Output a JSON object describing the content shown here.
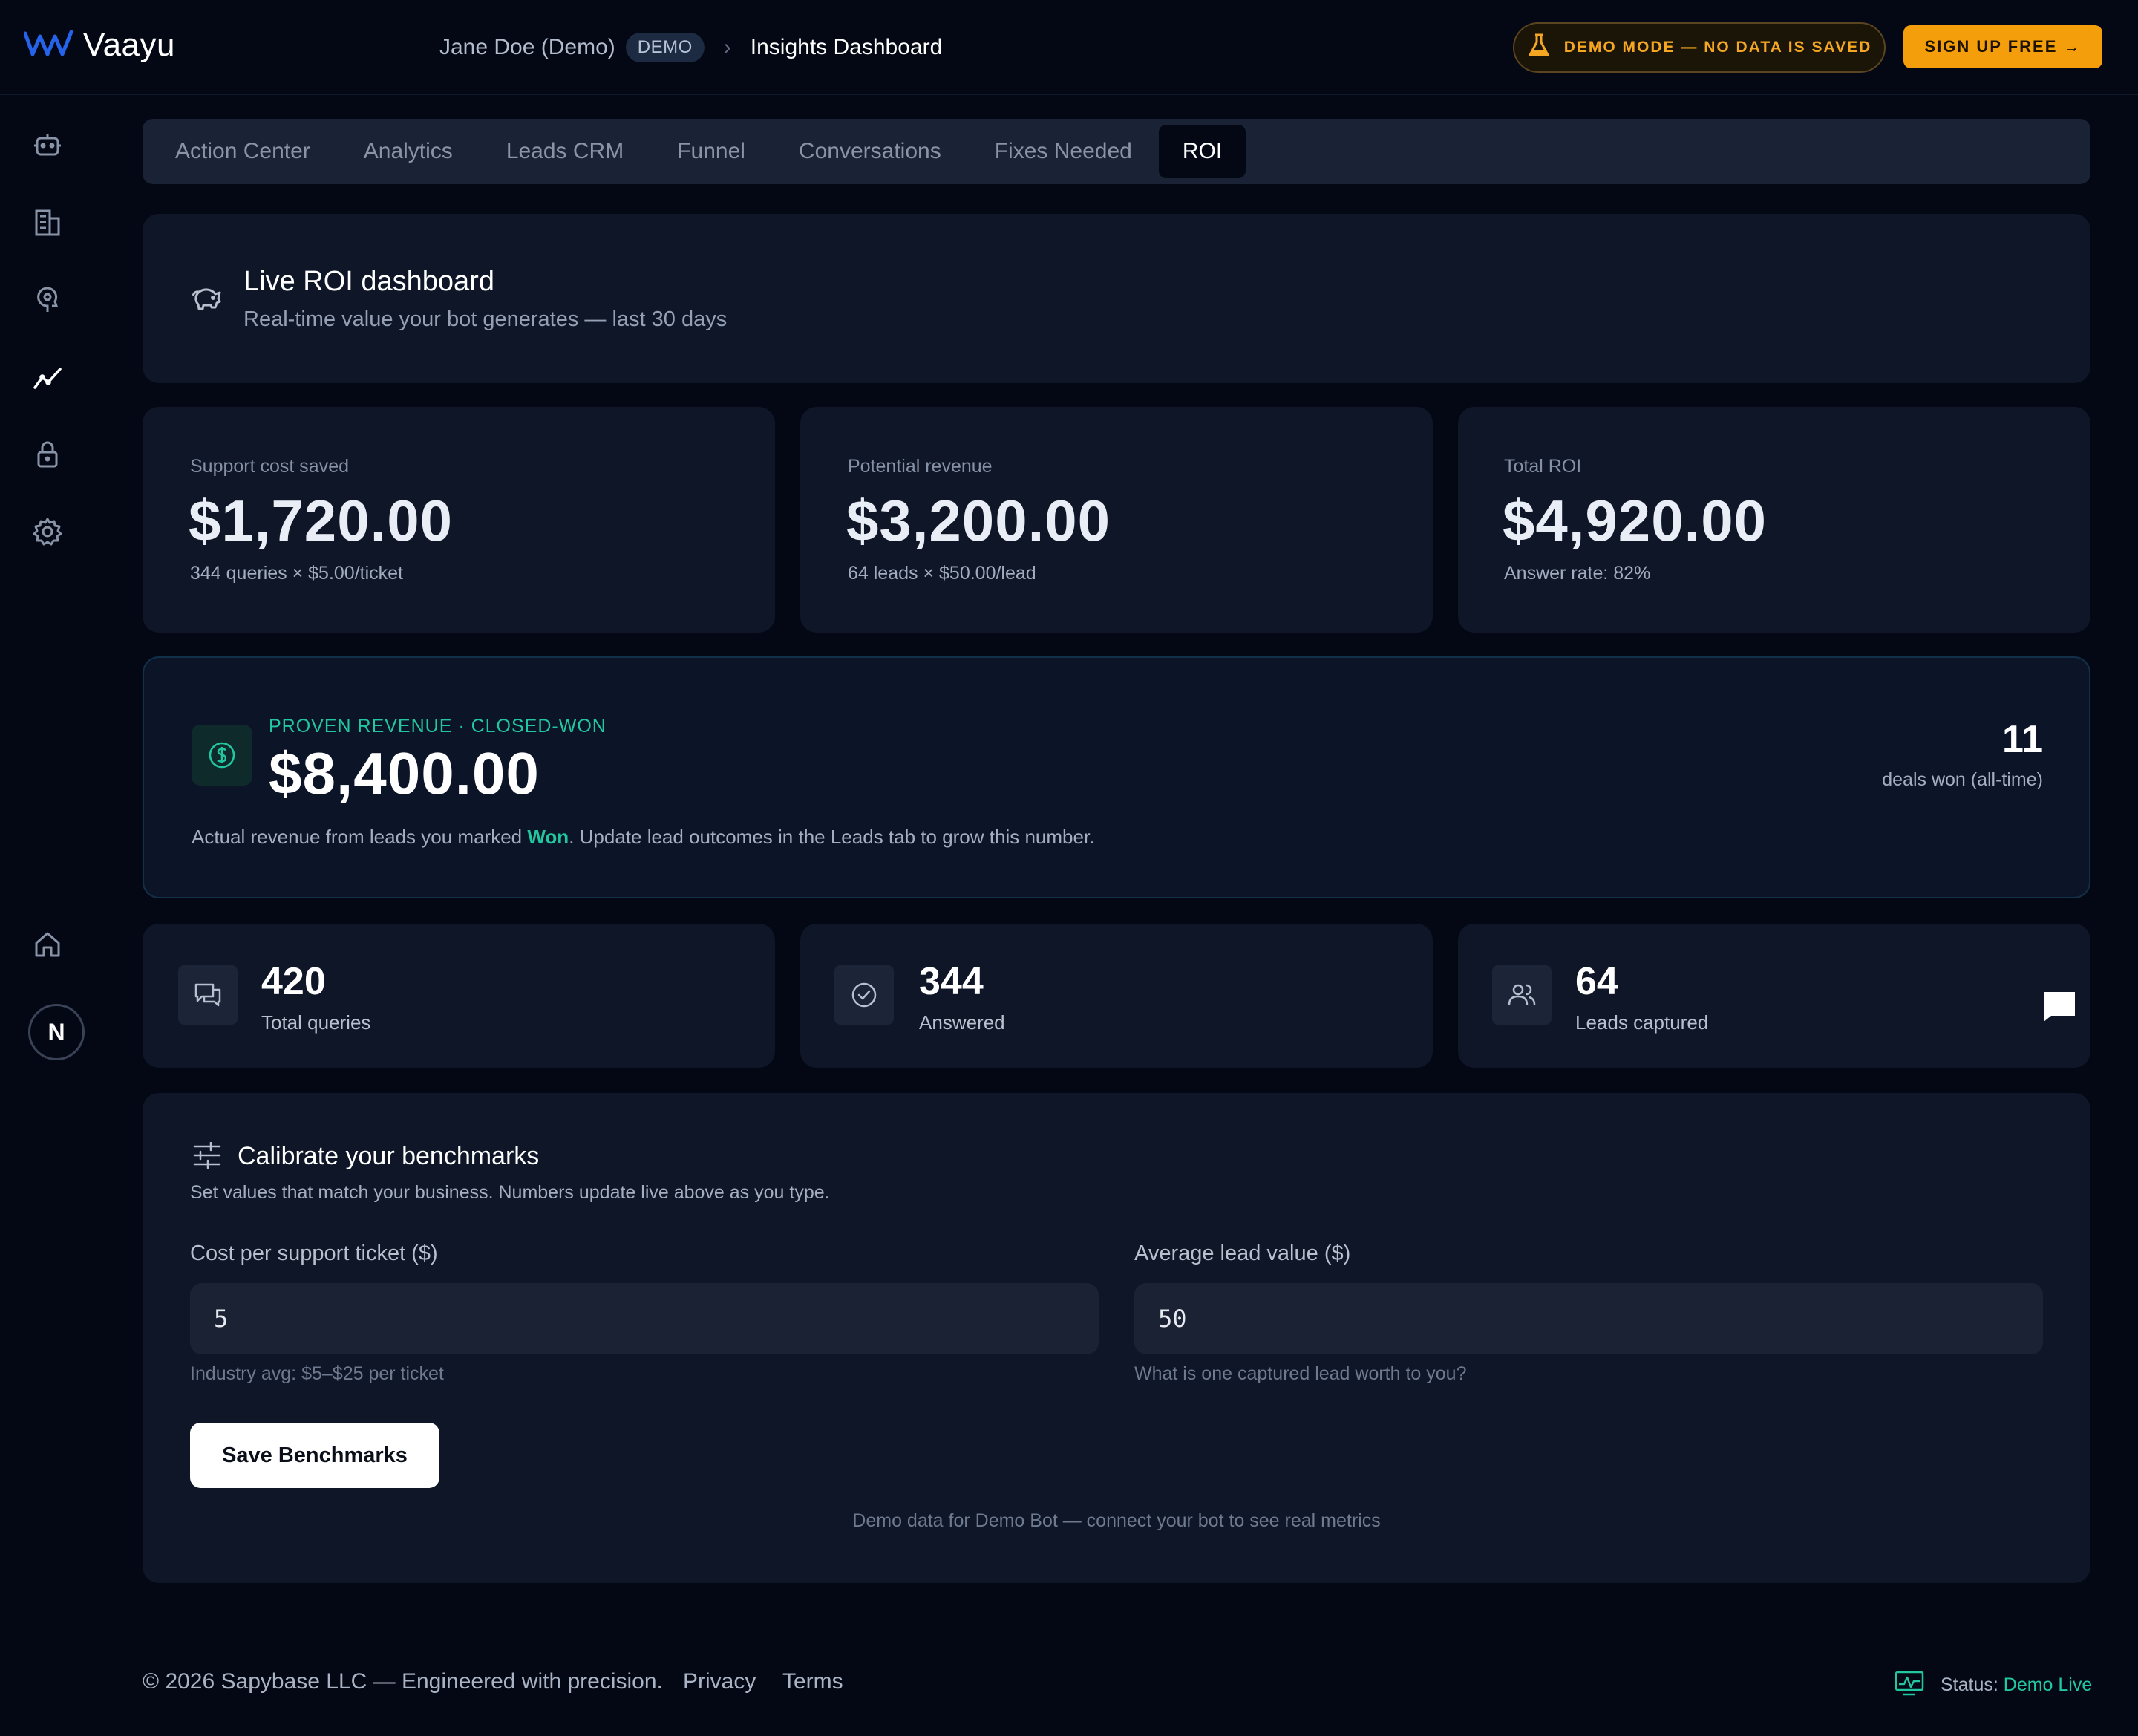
{
  "brand": {
    "name": "Vaayu"
  },
  "breadcrumb": {
    "user": "Jane Doe (Demo)",
    "badge": "DEMO",
    "separator": "›",
    "current": "Insights Dashboard"
  },
  "header": {
    "demo_mode": "DEMO MODE — NO DATA IS SAVED",
    "signup": "SIGN UP FREE →"
  },
  "sidebar": {
    "icons": [
      "bot-icon",
      "building-icon",
      "brain-icon",
      "analytics-icon",
      "lock-icon",
      "gear-icon",
      "home-icon"
    ],
    "avatar": "N"
  },
  "tabs": [
    {
      "label": "Action Center",
      "active": false
    },
    {
      "label": "Analytics",
      "active": false
    },
    {
      "label": "Leads CRM",
      "active": false
    },
    {
      "label": "Funnel",
      "active": false
    },
    {
      "label": "Conversations",
      "active": false
    },
    {
      "label": "Fixes Needed",
      "active": false
    },
    {
      "label": "ROI",
      "active": true
    }
  ],
  "hero": {
    "title": "Live ROI dashboard",
    "subtitle": "Real-time value your bot generates — last 30 days"
  },
  "stats": [
    {
      "label": "Support cost saved",
      "value": "$1,720.00",
      "foot": "344 queries × $5.00/ticket"
    },
    {
      "label": "Potential revenue",
      "value": "$3,200.00",
      "foot": "64 leads × $50.00/lead"
    },
    {
      "label": "Total ROI",
      "value": "$4,920.00",
      "foot": "Answer rate: 82%"
    }
  ],
  "proven": {
    "label": "PROVEN REVENUE · CLOSED-WON",
    "value": "$8,400.00",
    "desc_before": "Actual revenue from leads you marked ",
    "desc_won": "Won",
    "desc_after": ". Update lead outcomes in the Leads tab to grow this number.",
    "deals_count": "11",
    "deals_label": "deals won (all-time)"
  },
  "mini": [
    {
      "value": "420",
      "label": "Total queries"
    },
    {
      "value": "344",
      "label": "Answered"
    },
    {
      "value": "64",
      "label": "Leads captured"
    }
  ],
  "calibrate": {
    "title": "Calibrate your benchmarks",
    "subtitle": "Set values that match your business. Numbers update live above as you type.",
    "cost_label": "Cost per support ticket ($)",
    "cost_value": "5",
    "cost_hint": "Industry avg: $5–$25 per ticket",
    "lead_label": "Average lead value ($)",
    "lead_value": "50",
    "lead_hint": "What is one captured lead worth to you?",
    "save": "Save Benchmarks",
    "note": "Demo data for Demo Bot — connect your bot to see real metrics"
  },
  "footer": {
    "copy": "© 2026 Sapybase LLC — Engineered with precision.",
    "privacy": "Privacy",
    "terms": "Terms",
    "status_label": "Status: ",
    "status_value": "Demo Live"
  },
  "colors": {
    "accent_green": "#22c7a0",
    "accent_orange": "#f59e0b",
    "background": "#030814",
    "card": "#0e1628"
  }
}
